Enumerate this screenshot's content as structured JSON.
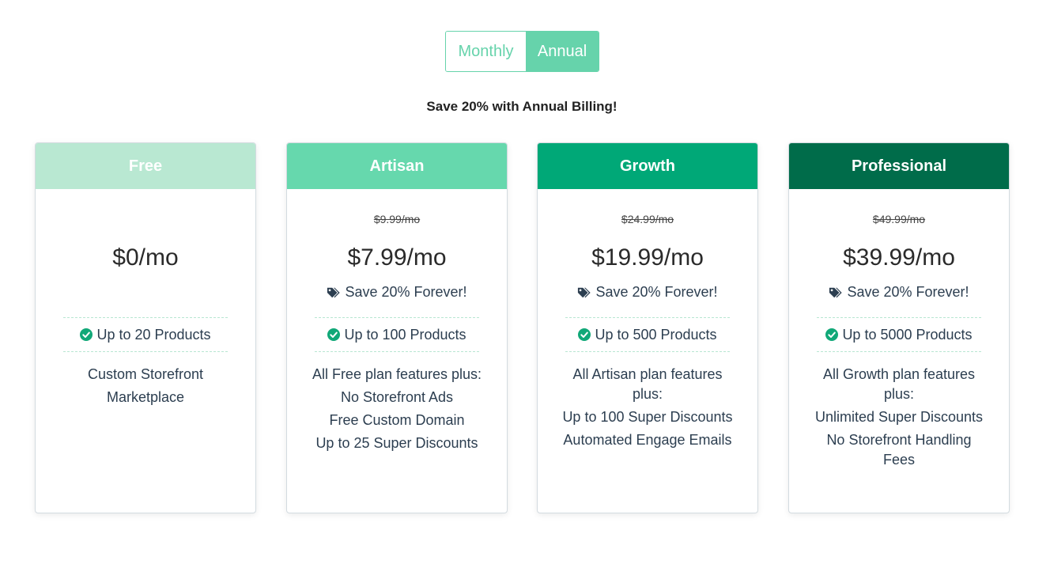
{
  "toggle": {
    "monthly": "Monthly",
    "annual": "Annual",
    "selected": "Annual"
  },
  "save_note": "Save 20% with Annual Billing!",
  "colors": {
    "free": "#b9e8d2",
    "artisan": "#66d8ad",
    "growth": "#00a877",
    "professional": "#006c4a",
    "accent": "#66d3ab",
    "check": "#11a878"
  },
  "plans": [
    {
      "name": "Free",
      "old_price": "",
      "price": "$0/mo",
      "savings": "",
      "products": "Up to 20 Products",
      "features": [
        "Custom Storefront",
        "Marketplace"
      ]
    },
    {
      "name": "Artisan",
      "old_price": "$9.99/mo",
      "price": "$7.99/mo",
      "savings": "Save 20% Forever!",
      "products": "Up to 100 Products",
      "features": [
        "All Free plan features plus:",
        "No Storefront Ads",
        "Free Custom Domain",
        "Up to 25 Super Discounts"
      ]
    },
    {
      "name": "Growth",
      "old_price": "$24.99/mo",
      "price": "$19.99/mo",
      "savings": "Save 20% Forever!",
      "products": "Up to 500 Products",
      "features": [
        "All Artisan plan features plus:",
        "Up to 100 Super Discounts",
        "Automated Engage Emails"
      ]
    },
    {
      "name": "Professional",
      "old_price": "$49.99/mo",
      "price": "$39.99/mo",
      "savings": "Save 20% Forever!",
      "products": "Up to 5000 Products",
      "features": [
        "All Growth plan features plus:",
        "Unlimited Super Discounts",
        "No Storefront Handling Fees"
      ]
    }
  ]
}
